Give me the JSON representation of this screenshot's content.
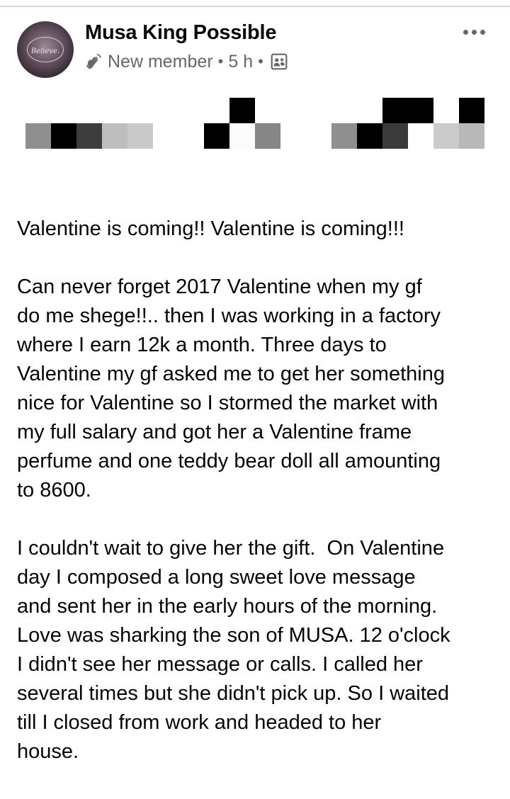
{
  "post": {
    "author": "Musa King Possible",
    "avatar_text": "Believe.",
    "badge": "New member",
    "time": "5 h",
    "separator": "•",
    "paragraphs": [
      "Valentine is coming!! Valentine is coming!!!",
      "Can never forget 2017 Valentine when my gf\ndo me shege!!.. then I was working in a factory\nwhere I earn 12k a month. Three days to\nValentine my gf asked me to get her something\nnice for Valentine so I stormed the market with\nmy full salary and got her a Valentine frame\nperfume and one teddy bear doll all amounting\nto 8600.",
      "I couldn't wait to give her the gift.  On Valentine\nday I composed a long sweet love message\nand sent her in the early hours of the morning.\nLove was sharking the son of MUSA. 12 o'clock\nI didn't see her message or calls. I called her\nseveral times but she didn't pick up. So I waited\ntill I closed from work and headed to her\nhouse."
    ]
  },
  "icons": {
    "badge": "waving-hand-icon",
    "audience": "group-audience-icon",
    "more": "more-options-icon"
  },
  "colors": {
    "text_primary": "#050505",
    "text_secondary": "#65676b",
    "divider": "#d9d9d9"
  }
}
